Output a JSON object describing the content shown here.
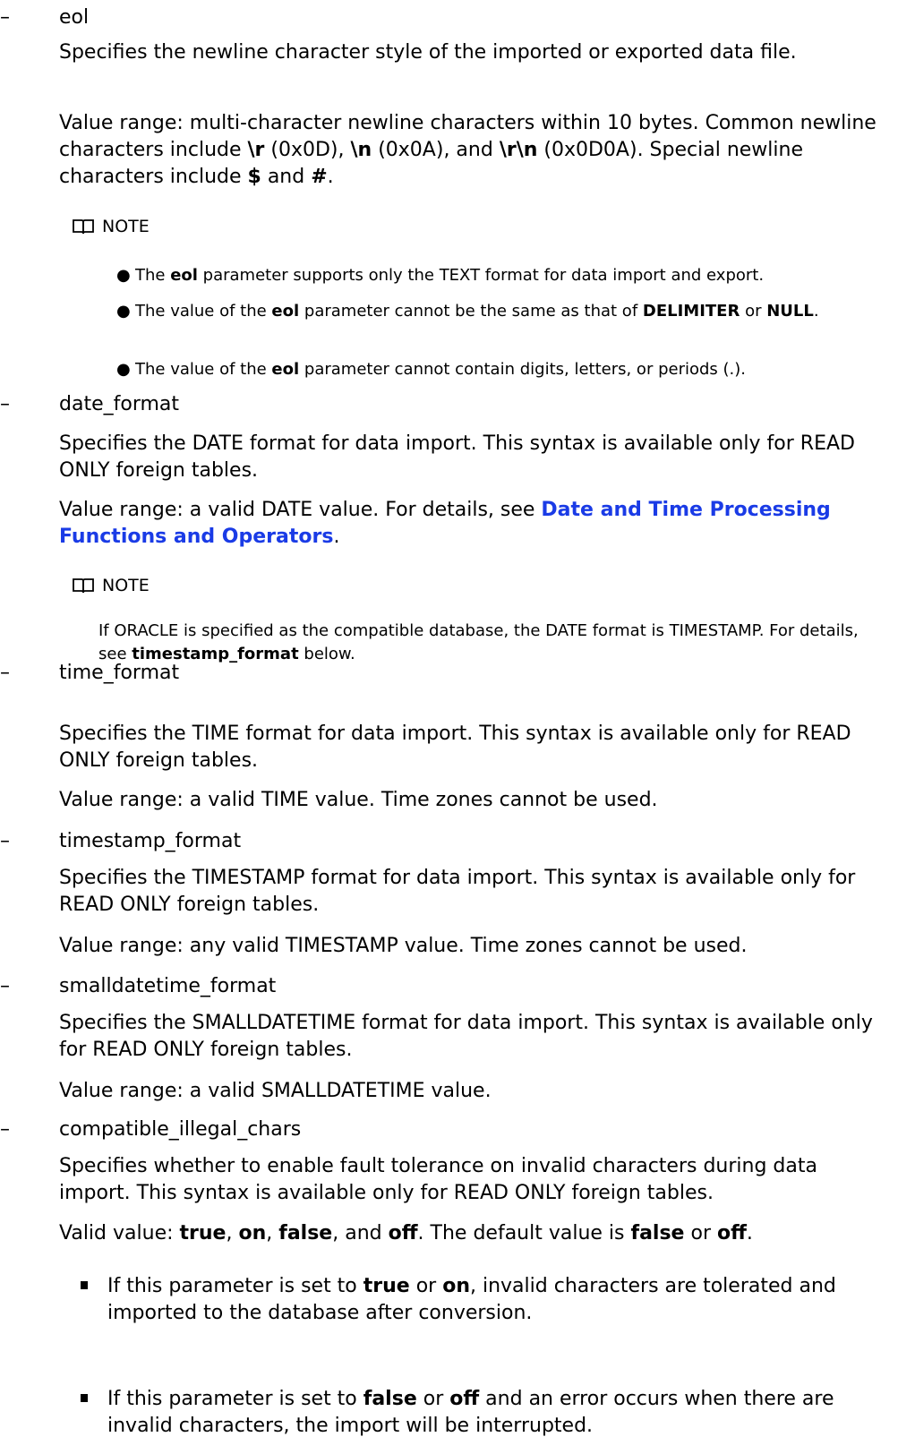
{
  "bullet_dash": "–",
  "note_label": "NOTE",
  "eol": {
    "name": "eol",
    "desc": "Specifies the newline character style of the imported or exported data file.",
    "range_1": "Value range: multi-character newline characters within 10 bytes. Common newline characters include ",
    "r": "\\r",
    "range_2": " (0x0D), ",
    "n": "\\n",
    "range_3": " (0x0A), and ",
    "rn": "\\r\\n",
    "range_4": " (0x0D0A). Special newline characters include ",
    "dollar": "$",
    "range_5": " and ",
    "hash": "#",
    "range_6": ".",
    "notes": {
      "n1_a": "The ",
      "n1_b": "eol",
      "n1_c": " parameter supports only the TEXT format for data import and export.",
      "n2_a": "The value of the ",
      "n2_b": "eol",
      "n2_c": " parameter cannot be the same as that of ",
      "n2_d": "DELIMITER",
      "n2_e": " or ",
      "n2_f": "NULL",
      "n2_g": ".",
      "n3_a": "The value of the ",
      "n3_b": "eol",
      "n3_c": " parameter cannot contain digits, letters, or periods (.)."
    }
  },
  "date_format": {
    "name": "date_format",
    "desc": "Specifies the DATE format for data import. This syntax is available only for READ ONLY foreign tables.",
    "range_a": "Value range: a valid DATE value. For details, see ",
    "link": "Date and Time Processing Functions and Operators",
    "range_b": ".",
    "note_a": "If ORACLE is specified as the compatible database, the DATE format is TIMESTAMP. For details, see ",
    "note_b": "timestamp_format",
    "note_c": " below."
  },
  "time_format": {
    "name": "time_format",
    "desc": "Specifies the TIME format for data import. This syntax is available only for READ ONLY foreign tables.",
    "range": "Value range: a valid TIME value. Time zones cannot be used."
  },
  "timestamp_format": {
    "name": "timestamp_format",
    "desc": "Specifies the TIMESTAMP format for data import. This syntax is available only for READ ONLY foreign tables.",
    "range": "Value range: any valid TIMESTAMP value. Time zones cannot be used."
  },
  "smalldatetime_format": {
    "name": "smalldatetime_format",
    "desc": "Specifies the SMALLDATETIME format for data import. This syntax is available only for READ ONLY foreign tables.",
    "range": "Value range: a valid SMALLDATETIME value."
  },
  "compatible_illegal_chars": {
    "name": "compatible_illegal_chars",
    "desc": "Specifies whether to enable fault tolerance on invalid characters during data import. This syntax is available only for READ ONLY foreign tables.",
    "v_a": "Valid value: ",
    "v_true": "true",
    "v_b": ", ",
    "v_on": "on",
    "v_c": ", ",
    "v_false": "false",
    "v_d": ", and ",
    "v_off": "off",
    "v_e": ". The default value is ",
    "v_false2": "false",
    "v_f": " or ",
    "v_off2": "off",
    "v_g": ".",
    "b1_a": "If this parameter is set to ",
    "b1_true": "true",
    "b1_b": " or ",
    "b1_on": "on",
    "b1_c": ", invalid characters are tolerated and imported to the database after conversion.",
    "b2_a": "If this parameter is set to ",
    "b2_false": "false",
    "b2_b": " or ",
    "b2_off": "off",
    "b2_c": " and an error occurs when there are invalid characters, the import will be interrupted."
  }
}
